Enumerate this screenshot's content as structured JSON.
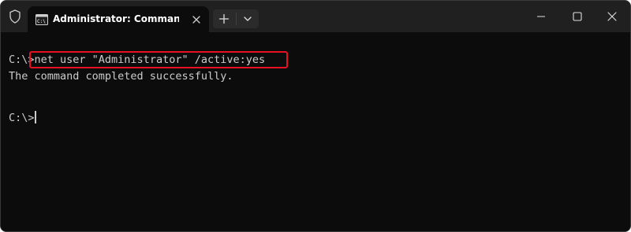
{
  "tab": {
    "title": "Administrator: Command Pro",
    "icon": "terminal-icon"
  },
  "titlebar": {
    "shield_icon": "shield-icon",
    "new_tab_icon": "plus-icon",
    "dropdown_icon": "chevron-down-icon",
    "minimize_icon": "minimize-icon",
    "maximize_icon": "maximize-icon",
    "close_icon": "close-icon"
  },
  "terminal": {
    "prompt": "C:\\>",
    "command": "net user \"Administrator\" /active:yes",
    "output": "The command completed successfully.",
    "prompt2": "C:\\>"
  },
  "colors": {
    "background": "#0c0c0c",
    "titlebar": "#202020",
    "text": "#cccccc",
    "highlight": "#e81123"
  }
}
